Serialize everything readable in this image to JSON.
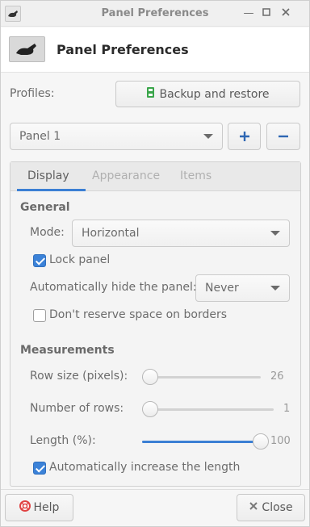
{
  "window": {
    "title": "Panel Preferences"
  },
  "header": {
    "title": "Panel Preferences"
  },
  "profiles": {
    "label": "Profiles:",
    "backup_label": "Backup and restore"
  },
  "panel_select": {
    "value": "Panel 1"
  },
  "tabs": [
    {
      "label": "Display",
      "active": true
    },
    {
      "label": "Appearance",
      "active": false
    },
    {
      "label": "Items",
      "active": false
    }
  ],
  "general": {
    "title": "General",
    "mode_label": "Mode:",
    "mode_value": "Horizontal",
    "lock_panel_label": "Lock panel",
    "lock_panel_checked": true,
    "autohide_label": "Automatically hide the panel:",
    "autohide_value": "Never",
    "reserve_label": "Don't reserve space on borders",
    "reserve_checked": false
  },
  "measurements": {
    "title": "Measurements",
    "row_size_label": "Row size (pixels):",
    "row_size_value": "26",
    "row_size_fraction": 0.04,
    "rows_label": "Number of rows:",
    "rows_value": "1",
    "rows_fraction": 0.0,
    "length_label": "Length (%):",
    "length_value": "100",
    "length_fraction": 1.0,
    "auto_length_label": "Automatically increase the length",
    "auto_length_checked": true
  },
  "footer": {
    "help_label": "Help",
    "close_label": "Close"
  },
  "colors": {
    "accent": "#3b7fd4",
    "help_icon": "#e04343",
    "backup_icon": "#3aa54a"
  }
}
